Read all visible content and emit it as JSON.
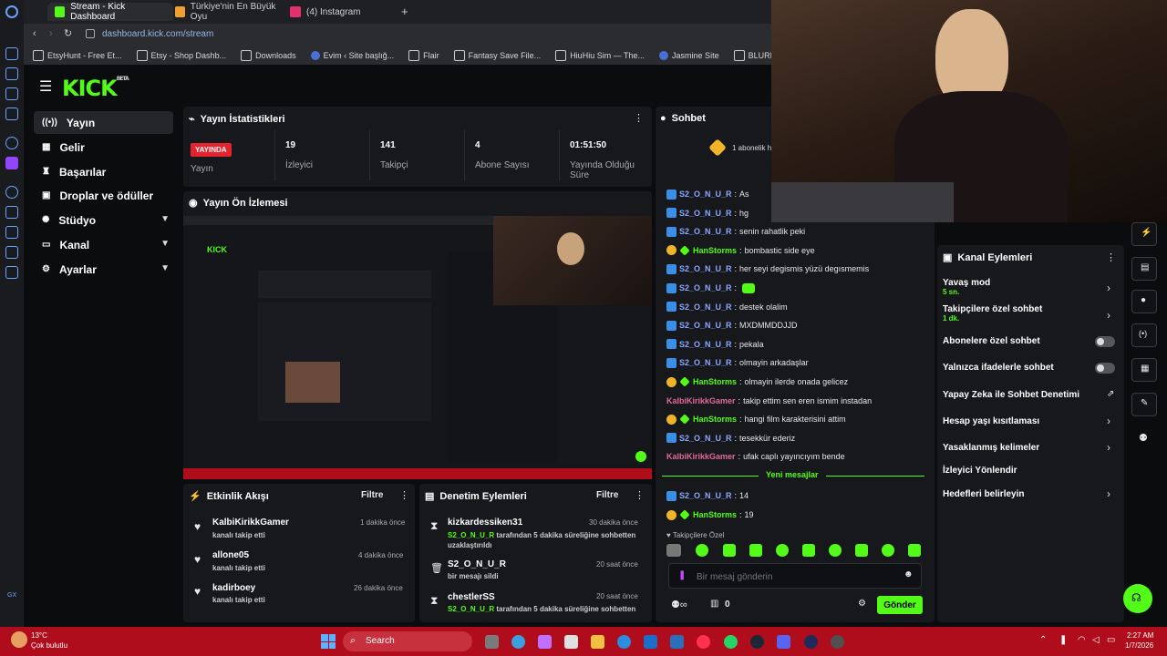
{
  "browser": {
    "tabs": [
      {
        "label": "Stream - Kick Dashboard",
        "color": "#53fc18"
      },
      {
        "label": "Türkiye'nin En Büyük Oyu",
        "color": "#f0a030"
      },
      {
        "label": "(4) Instagram",
        "color": "#e1306c"
      }
    ],
    "url": "dashboard.kick.com/stream",
    "bookmarks": [
      "EtsyHunt - Free Et...",
      "Etsy - Shop Dashb...",
      "Downloads",
      "Evim ‹ Site başlığ...",
      "Flair",
      "Fantasy Save File...",
      "HiuHiu Sim — The...",
      "Jasmine Site",
      "BLURRED BUILDS..."
    ]
  },
  "kick": {
    "logo": "KICK",
    "logo_sup": "BETA",
    "accent": "#53fc18",
    "sidebar": [
      {
        "label": "Yayın",
        "active": true,
        "icon": "broadcast-icon"
      },
      {
        "label": "Gelir",
        "icon": "revenue-icon"
      },
      {
        "label": "Başarılar",
        "icon": "trophy-icon"
      },
      {
        "label": "Droplar ve ödüller",
        "icon": "gift-icon"
      },
      {
        "label": "Stüdyo",
        "icon": "studio-icon"
      },
      {
        "label": "Kanal",
        "icon": "channel-icon"
      },
      {
        "label": "Ayarlar",
        "icon": "settings-icon"
      }
    ]
  },
  "stats": {
    "title": "Yayın İstatistikleri",
    "live_badge": "YAYINDA",
    "items": [
      {
        "value": "",
        "label": "Yayın"
      },
      {
        "value": "19",
        "label": "İzleyici"
      },
      {
        "value": "141",
        "label": "Takipçi"
      },
      {
        "value": "4",
        "label": "Abone Sayısı"
      },
      {
        "value": "01:51:50",
        "label": "Yayında Olduğu Süre"
      }
    ]
  },
  "preview": {
    "title": "Yayın Ön İzlemesi"
  },
  "chat": {
    "title": "Sohbet",
    "sub_notice": "1 abonelik h",
    "messages": [
      {
        "user": "S2_O_N_U_R",
        "text": "As",
        "badge": "blue",
        "ucls": "u1"
      },
      {
        "user": "S2_O_N_U_R",
        "text": "hg",
        "badge": "blue",
        "ucls": "u1"
      },
      {
        "user": "S2_O_N_U_R",
        "text": "senin rahatlik peki",
        "badge": "blue",
        "ucls": "u1"
      },
      {
        "user": "HanStorms",
        "text": "bombastic side eye",
        "badge": "gold",
        "ucls": "u2"
      },
      {
        "user": "S2_O_N_U_R",
        "text": "her seyi degismis yüzü degısmemis",
        "badge": "blue",
        "ucls": "u1"
      },
      {
        "user": "S2_O_N_U_R",
        "text": "",
        "badge": "blue",
        "ucls": "u1"
      },
      {
        "user": "S2_O_N_U_R",
        "text": "destek olalim",
        "badge": "blue",
        "ucls": "u1"
      },
      {
        "user": "S2_O_N_U_R",
        "text": "MXDMMDDJJD",
        "badge": "blue",
        "ucls": "u1"
      },
      {
        "user": "S2_O_N_U_R",
        "text": "pekala",
        "badge": "blue",
        "ucls": "u1"
      },
      {
        "user": "S2_O_N_U_R",
        "text": "olmayin arkadaşlar",
        "badge": "blue",
        "ucls": "u1"
      },
      {
        "user": "HanStorms",
        "text": "olmayin ilerde onada gelicez",
        "badge": "gold",
        "ucls": "u2"
      },
      {
        "user": "KalbiKirikkGamer",
        "text": "takip ettim sen eren ismim instadan",
        "badge": "",
        "ucls": "u3"
      },
      {
        "user": "HanStorms",
        "text": "hangi film karakterisini attim",
        "badge": "gold",
        "ucls": "u2"
      },
      {
        "user": "S2_O_N_U_R",
        "text": "tesekkür ederiz",
        "badge": "blue",
        "ucls": "u1"
      },
      {
        "user": "KalbiKirikkGamer",
        "text": "ufak caplı yayıncıyım bende",
        "badge": "",
        "ucls": "u3"
      }
    ],
    "new_messages": "Yeni mesajlar",
    "new": [
      {
        "user": "S2_O_N_U_R",
        "text": "14",
        "badge": "blue",
        "ucls": "u1"
      },
      {
        "user": "HanStorms",
        "text": "19",
        "badge": "gold",
        "ucls": "u2"
      }
    ],
    "follower_mode": "Takipçilere Özel",
    "input_placeholder": "Bir mesaj gönderin",
    "count": "0",
    "send": "Gönder"
  },
  "channel_actions": {
    "title": "Kanal Eylemleri",
    "items": [
      {
        "label": "Yavaş mod",
        "sub": "5 sn.",
        "control": "chevron"
      },
      {
        "label": "Takipçilere özel sohbet",
        "sub": "1 dk.",
        "control": "chevron"
      },
      {
        "label": "Abonelere özel sohbet",
        "sub": "",
        "control": "toggle"
      },
      {
        "label": "Yalnızca ifadelerle sohbet",
        "sub": "",
        "control": "toggle"
      },
      {
        "label": "Yapay Zeka ile Sohbet Denetimi",
        "sub": "",
        "control": "external"
      },
      {
        "label": "Hesap yaşı kısıtlaması",
        "sub": "",
        "control": "chevron"
      },
      {
        "label": "Yasaklanmış kelimeler",
        "sub": "",
        "control": "chevron"
      },
      {
        "label": "İzleyici Yönlendir",
        "sub": "",
        "control": "none"
      },
      {
        "label": "Hedefleri belirleyin",
        "sub": "",
        "control": "chevron"
      }
    ]
  },
  "activity": {
    "title": "Etkinlik Akışı",
    "filter": "Filtre",
    "items": [
      {
        "name": "KalbiKirikkGamer",
        "sub": "kanalı takip etti",
        "time": "1 dakika önce"
      },
      {
        "name": "allone05",
        "sub": "kanalı takip etti",
        "time": "4 dakika önce"
      },
      {
        "name": "kadirboey",
        "sub": "kanalı takip etti",
        "time": "26 dakika önce"
      }
    ]
  },
  "moderation": {
    "title": "Denetim Eylemleri",
    "filter": "Filtre",
    "items": [
      {
        "name": "kizkardessiken31",
        "mod": "S2_O_N_U_R",
        "sub": "tarafından 5 dakika süreliğine sohbetten uzaklaştırıldı",
        "time": "30 dakika önce",
        "icon": "hourglass-icon"
      },
      {
        "name": "S2_O_N_U_R",
        "mod": "",
        "sub": "bir mesajı sildi",
        "time": "20 saat önce",
        "icon": "trash-icon"
      },
      {
        "name": "chestlerSS",
        "mod": "S2_O_N_U_R",
        "sub": "tarafından 5 dakika süreliğine sohbetten",
        "time": "20 saat önce",
        "icon": "hourglass-icon"
      }
    ]
  },
  "taskbar": {
    "weather_temp": "13°C",
    "weather_desc": "Çok bulutlu",
    "search": "Search",
    "time": "2:27 AM",
    "date": "1/7/2026"
  }
}
